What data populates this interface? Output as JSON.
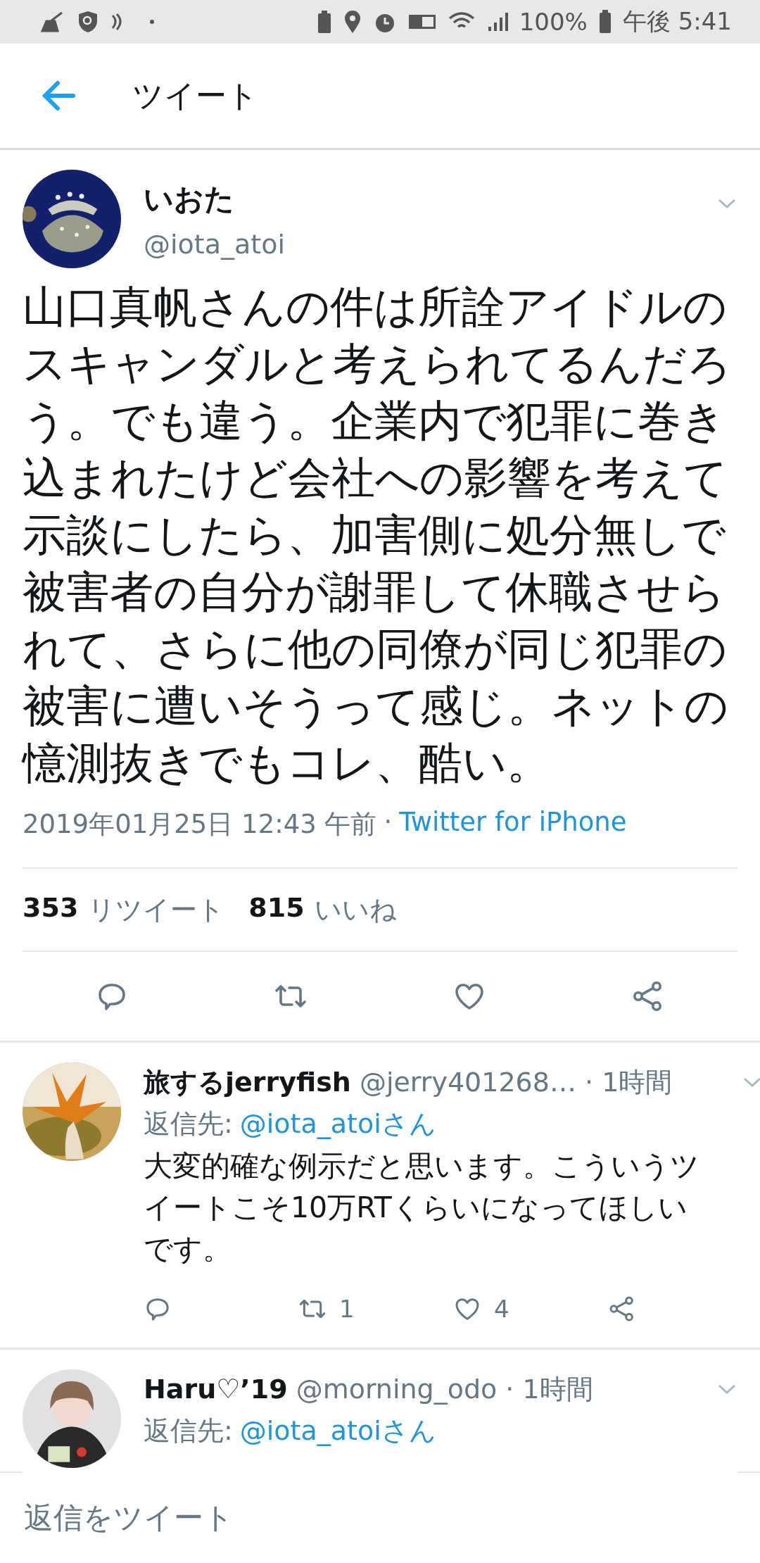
{
  "status_bar": {
    "battery": "100%",
    "time": "午後 5:41"
  },
  "header": {
    "title": "ツイート"
  },
  "tweet": {
    "name": "いおた",
    "handle": "@iota_atoi",
    "text": "山口真帆さんの件は所詮アイドルのスキャンダルと考えられてるんだろう。でも違う。企業内で犯罪に巻き込まれたけど会社への影響を考えて示談にしたら、加害側に処分無しで被害者の自分が謝罪して休職させられて、さらに他の同僚が同じ犯罪の被害に遭いそうって感じ。ネットの憶測抜きでもコレ、酷い。",
    "timestamp": "2019年01月25日 12:43 午前",
    "separator": "·",
    "source": "Twitter for iPhone",
    "stats": [
      {
        "count": "353",
        "label": "リツイート"
      },
      {
        "count": "815",
        "label": "いいね"
      }
    ]
  },
  "replies": [
    {
      "name": "旅するjerryfish",
      "handle": "@jerry401268…",
      "time": "· 1時間",
      "reply_to_label": "返信先:",
      "reply_to": "@iota_atoiさん",
      "text": "大変的確な例示だと思います。こういうツイートこそ10万RTくらいになってほしいです。",
      "retweet_count": "1",
      "like_count": "4"
    },
    {
      "name": "Haru♡’19",
      "handle": "@morning_odo",
      "time": "· 1時間",
      "reply_to_label": "返信先:",
      "reply_to": "@iota_atoiさん"
    }
  ],
  "composer": {
    "placeholder": "返信をツイート"
  }
}
